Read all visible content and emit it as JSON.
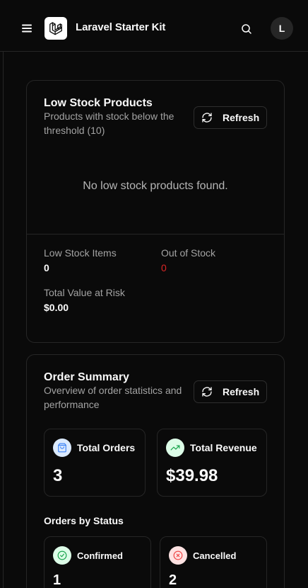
{
  "app": {
    "title": "Laravel Starter Kit",
    "avatar_initial": "L"
  },
  "low_stock": {
    "title": "Low Stock Products",
    "description": "Products with stock below the threshold (10)",
    "refresh_label": "Refresh",
    "empty_message": "No low stock products found.",
    "stats": {
      "low_stock_items_label": "Low Stock Items",
      "low_stock_items_value": "0",
      "out_of_stock_label": "Out of Stock",
      "out_of_stock_value": "0",
      "total_value_label": "Total Value at Risk",
      "total_value_value": "$0.00"
    }
  },
  "order_summary": {
    "title": "Order Summary",
    "description": "Overview of order statistics and performance",
    "refresh_label": "Refresh",
    "total_orders_label": "Total Orders",
    "total_orders_value": "3",
    "total_revenue_label": "Total Revenue",
    "total_revenue_value": "$39.98",
    "orders_by_status_label": "Orders by Status",
    "statuses": [
      {
        "label": "Confirmed",
        "value": "1"
      },
      {
        "label": "Cancelled",
        "value": "2"
      }
    ]
  },
  "colors": {
    "background": "#0a0a0a",
    "border": "#262626",
    "muted_text": "#a3a3a3",
    "danger": "#dc2626",
    "blue_accent": "#3b82f6",
    "green_accent": "#16a34a",
    "red_accent": "#ef4444"
  },
  "icons": {
    "menu": "menu-icon",
    "logo": "laravel-logo-icon",
    "search": "search-icon",
    "refresh": "refresh-icon",
    "orders": "shopping-bag-icon",
    "revenue": "trending-up-icon",
    "confirmed": "check-circle-icon",
    "cancelled": "x-circle-icon"
  }
}
